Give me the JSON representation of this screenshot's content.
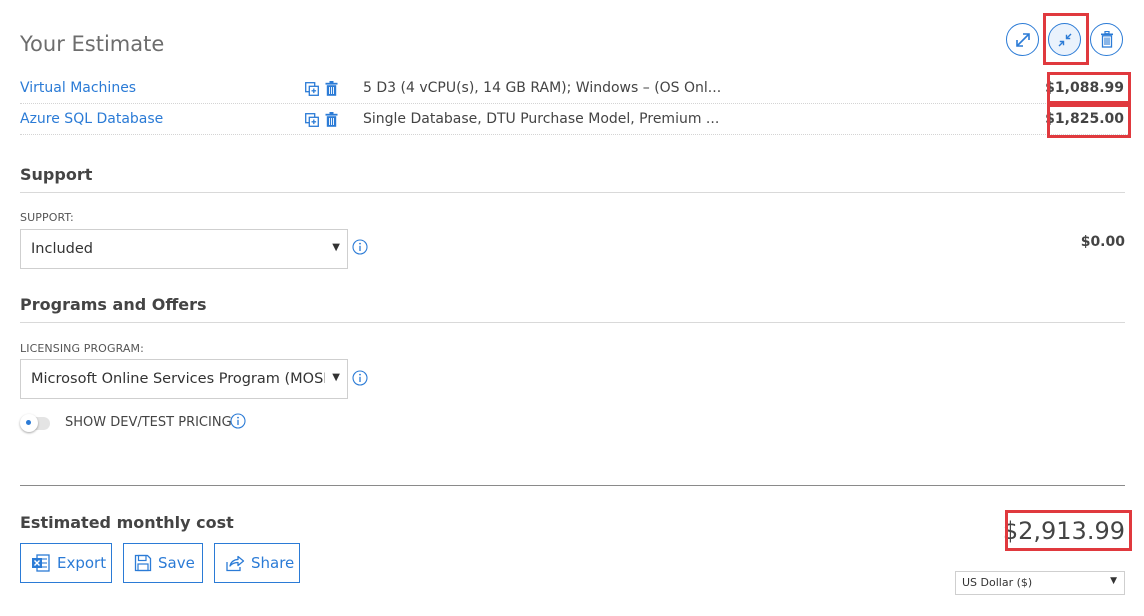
{
  "header": {
    "title": "Your Estimate",
    "buttons": [
      {
        "name": "expand-all-button",
        "icon": "expand-icon"
      },
      {
        "name": "collapse-all-button",
        "icon": "collapse-icon"
      },
      {
        "name": "delete-all-button",
        "icon": "trash-icon"
      }
    ]
  },
  "estimate": {
    "rows": [
      {
        "name": "Virtual Machines",
        "description": "5 D3 (4 vCPU(s), 14 GB RAM); Windows – (OS Onl...",
        "price": "$1,088.99"
      },
      {
        "name": "Azure SQL Database",
        "description": "Single Database, DTU Purchase Model, Premium ...",
        "price": "$1,825.00"
      }
    ]
  },
  "support": {
    "title": "Support",
    "label": "SUPPORT:",
    "value": "Included",
    "price": "$0.00"
  },
  "programs": {
    "title": "Programs and Offers",
    "label": "LICENSING PROGRAM:",
    "value": "Microsoft Online Services Program (MOSP)",
    "dev_test_label": "SHOW DEV/TEST PRICING",
    "dev_test_enabled": false
  },
  "footer": {
    "label": "Estimated monthly cost",
    "export_label": "Export",
    "save_label": "Save",
    "share_label": "Share",
    "total": "$2,913.99",
    "currency": "US Dollar ($)"
  },
  "colors": {
    "accent": "#2b7bd6",
    "highlight": "#e0393e"
  }
}
